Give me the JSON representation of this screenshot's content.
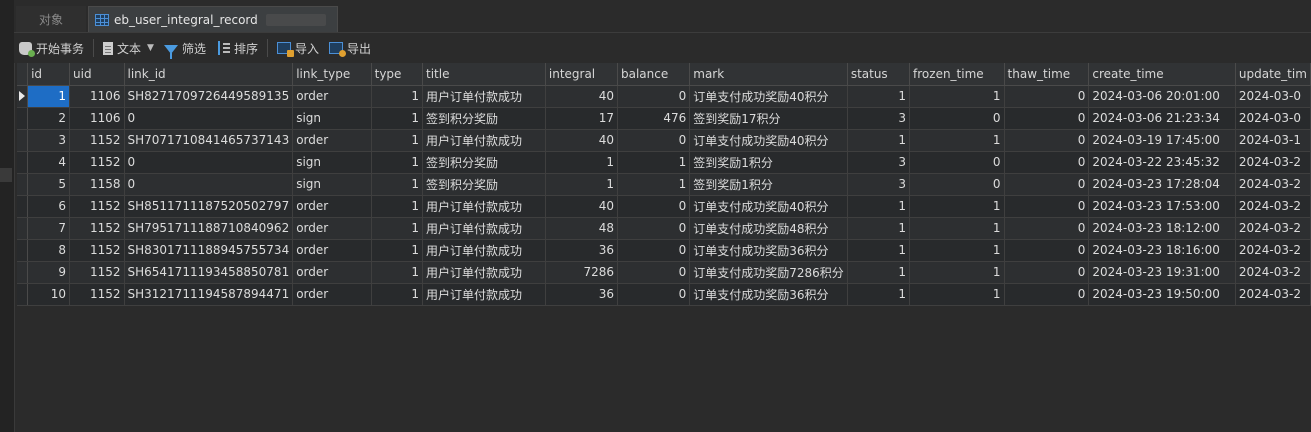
{
  "tabs": {
    "objects": "对象",
    "table": "eb_user_integral_record"
  },
  "toolbar": {
    "begin_transaction": "开始事务",
    "text": "文本",
    "filter": "筛选",
    "sort": "排序",
    "import": "导入",
    "export": "导出"
  },
  "grid": {
    "columns": [
      "id",
      "uid",
      "link_id",
      "link_type",
      "type",
      "title",
      "integral",
      "balance",
      "mark",
      "status",
      "frozen_time",
      "thaw_time",
      "create_time",
      "update_tim"
    ],
    "rows": [
      [
        "1",
        "1106",
        "SH8271709726449589135",
        "order",
        "1",
        "用户订单付款成功",
        "40",
        "0",
        "订单支付成功奖励40积分",
        "1",
        "1",
        "0",
        "2024-03-06 20:01:00",
        "2024-03-0"
      ],
      [
        "2",
        "1106",
        "0",
        "sign",
        "1",
        "签到积分奖励",
        "17",
        "476",
        "签到奖励17积分",
        "3",
        "0",
        "0",
        "2024-03-06 21:23:34",
        "2024-03-0"
      ],
      [
        "3",
        "1152",
        "SH7071710841465737143",
        "order",
        "1",
        "用户订单付款成功",
        "40",
        "0",
        "订单支付成功奖励40积分",
        "1",
        "1",
        "0",
        "2024-03-19 17:45:00",
        "2024-03-1"
      ],
      [
        "4",
        "1152",
        "0",
        "sign",
        "1",
        "签到积分奖励",
        "1",
        "1",
        "签到奖励1积分",
        "3",
        "0",
        "0",
        "2024-03-22 23:45:32",
        "2024-03-2"
      ],
      [
        "5",
        "1158",
        "0",
        "sign",
        "1",
        "签到积分奖励",
        "1",
        "1",
        "签到奖励1积分",
        "3",
        "0",
        "0",
        "2024-03-23 17:28:04",
        "2024-03-2"
      ],
      [
        "6",
        "1152",
        "SH8511711187520502797",
        "order",
        "1",
        "用户订单付款成功",
        "40",
        "0",
        "订单支付成功奖励40积分",
        "1",
        "1",
        "0",
        "2024-03-23 17:53:00",
        "2024-03-2"
      ],
      [
        "7",
        "1152",
        "SH7951711188710840962",
        "order",
        "1",
        "用户订单付款成功",
        "48",
        "0",
        "订单支付成功奖励48积分",
        "1",
        "1",
        "0",
        "2024-03-23 18:12:00",
        "2024-03-2"
      ],
      [
        "8",
        "1152",
        "SH8301711188945755734",
        "order",
        "1",
        "用户订单付款成功",
        "36",
        "0",
        "订单支付成功奖励36积分",
        "1",
        "1",
        "0",
        "2024-03-23 18:16:00",
        "2024-03-2"
      ],
      [
        "9",
        "1152",
        "SH6541711193458850781",
        "order",
        "1",
        "用户订单付款成功",
        "7286",
        "0",
        "订单支付成功奖励7286积分",
        "1",
        "1",
        "0",
        "2024-03-23 19:31:00",
        "2024-03-2"
      ],
      [
        "10",
        "1152",
        "SH3121711194587894471",
        "order",
        "1",
        "用户订单付款成功",
        "36",
        "0",
        "订单支付成功奖励36积分",
        "1",
        "1",
        "0",
        "2024-03-23 19:50:00",
        "2024-03-2"
      ]
    ]
  },
  "colors": {
    "selection": "#1e6dc5",
    "accent": "#4b9be0"
  }
}
